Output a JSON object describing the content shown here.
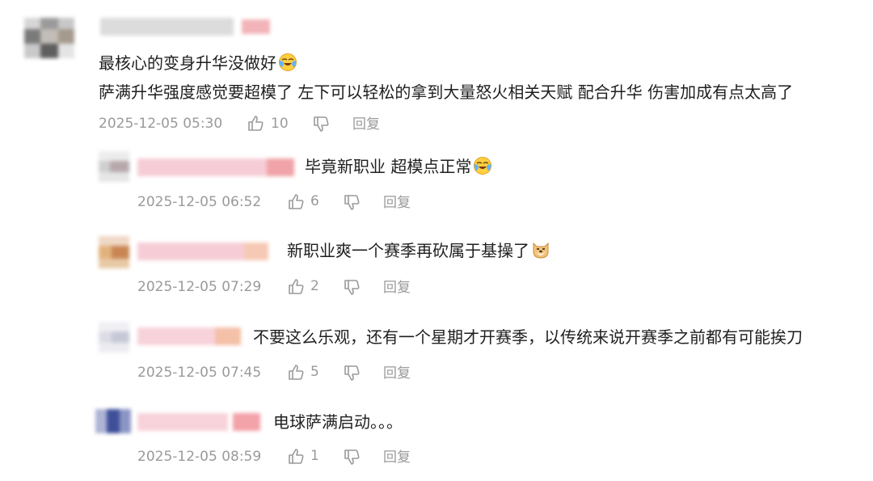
{
  "main_comment": {
    "lines": [
      "最核心的变身升华没做好",
      "萨满升华强度感觉要超模了 左下可以轻松的拿到大量怒火相关天赋 配合升华 伤害加成有点太高了"
    ],
    "emoji": "crying-laugh-emoji",
    "timestamp": "2025-12-05 05:30",
    "likes": "10",
    "reply_label": "回复"
  },
  "replies": [
    {
      "text": "毕竟新职业 超模点正常",
      "emoji": "crying-laugh-emoji",
      "timestamp": "2025-12-05 06:52",
      "likes": "6",
      "reply_label": "回复"
    },
    {
      "text": "新职业爽一个赛季再砍属于基操了",
      "emoji": "doge-emoji",
      "timestamp": "2025-12-05 07:29",
      "likes": "2",
      "reply_label": "回复"
    },
    {
      "text": "不要这么乐观，还有一个星期才开赛季，以传统来说开赛季之前都有可能挨刀",
      "emoji": "",
      "timestamp": "2025-12-05 07:45",
      "likes": "5",
      "reply_label": "回复"
    },
    {
      "text": "电球萨满启动。。。",
      "emoji": "",
      "timestamp": "2025-12-05 08:59",
      "likes": "1",
      "reply_label": "回复"
    }
  ],
  "colors": {
    "text": "#1f1f1f",
    "meta": "#9a9a9a"
  }
}
